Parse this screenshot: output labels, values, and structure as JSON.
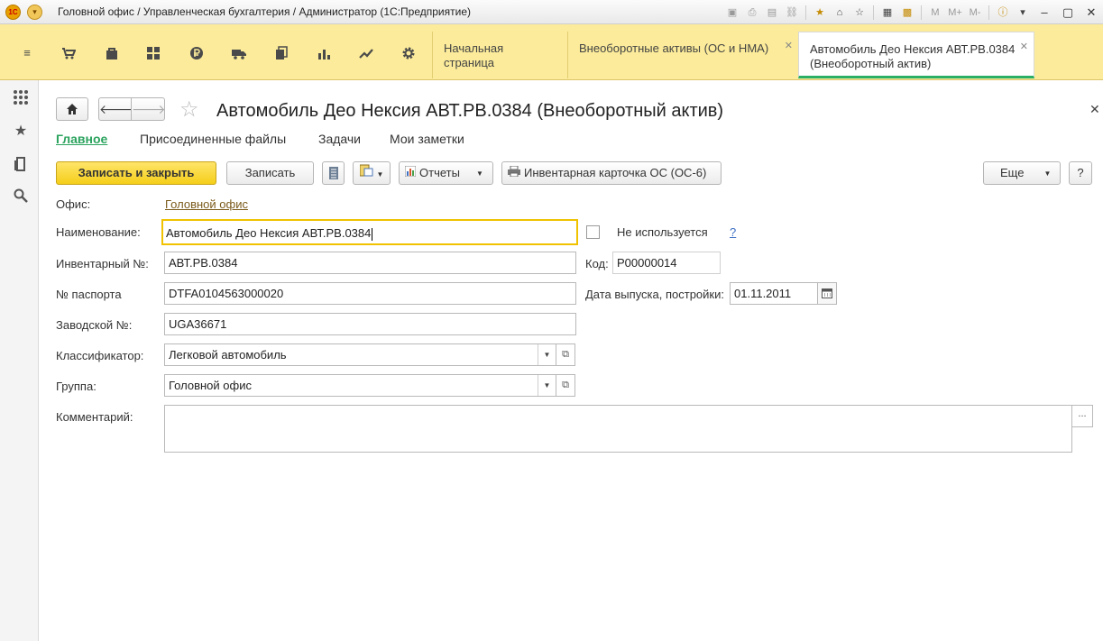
{
  "window": {
    "title": "Головной офис / Управленческая бухгалтерия / Администратор  (1С:Предприятие)",
    "logo_text": "1С",
    "toolbar_letters": {
      "m": "M",
      "m_plus": "M+",
      "m_minus": "M-"
    }
  },
  "mainbar": {
    "icons": [
      "menu-icon",
      "cart-icon",
      "bag-icon",
      "warehouse-icon",
      "ruble-icon",
      "truck-icon",
      "documents-icon",
      "bar-chart-icon",
      "trend-icon",
      "gear-icon"
    ],
    "tabs": [
      {
        "label": "Начальная страница"
      },
      {
        "label": "Внеоборотные активы (ОС и НМА)"
      },
      {
        "label": "Автомобиль Део Нексия АВТ.РВ.0384  (Внеоборотный актив)"
      }
    ]
  },
  "form": {
    "title": "Автомобиль Део Нексия АВТ.РВ.0384 (Внеоборотный актив)",
    "sections": [
      "Главное",
      "Присоединенные файлы",
      "Задачи",
      "Мои заметки"
    ],
    "commands": {
      "save_close": "Записать и закрыть",
      "save": "Записать",
      "reports": "Отчеты",
      "inventory_card": "Инвентарная карточка ОС (ОС-6)",
      "more": "Еще",
      "help": "?"
    },
    "fields": {
      "office_label": "Офис:",
      "office_value": "Головной офис",
      "name_label": "Наименование:",
      "name_value": "Автомобиль Део Нексия АВТ.РВ.0384",
      "not_used_label": "Не используется",
      "help_link": "?",
      "inv_label": "Инвентарный №:",
      "inv_value": "АВТ.РВ.0384",
      "code_label": "Код:",
      "code_value": "Р00000014",
      "passport_label": "№ паспорта",
      "passport_value": "DTFA0104563000020",
      "release_label": "Дата выпуска, постройки:",
      "release_value": "01.11.2011",
      "factory_label": "Заводской №:",
      "factory_value": "UGA36671",
      "classifier_label": "Классификатор:",
      "classifier_value": "Легковой автомобиль",
      "group_label": "Группа:",
      "group_value": "Головной офис",
      "comment_label": "Комментарий:",
      "comment_value": "",
      "comment_more": "..."
    }
  }
}
